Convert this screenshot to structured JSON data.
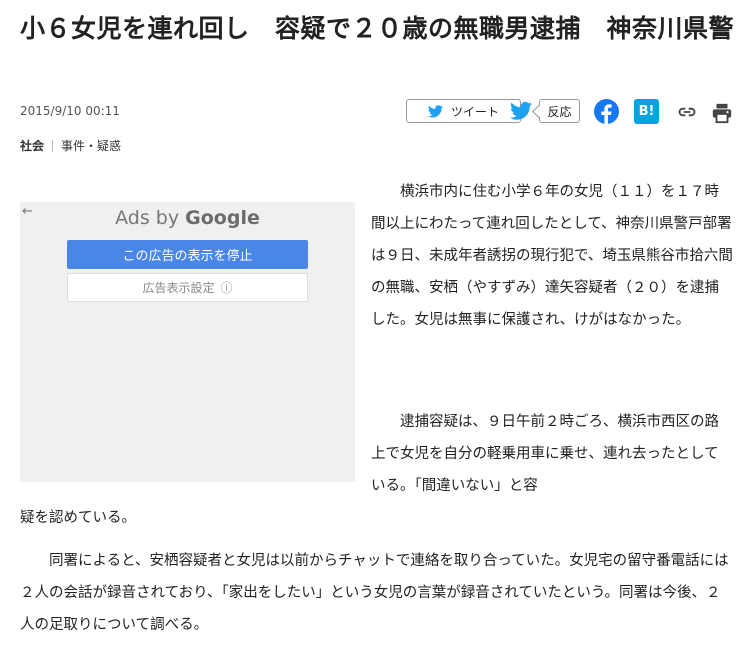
{
  "article": {
    "headline": "小６女児を連れ回し　容疑で２０歳の無職男逮捕　神奈川県警",
    "date": "2015/9/10 00:11",
    "category_primary": "社会",
    "category_secondary": "事件・疑惑",
    "paragraph1_float": "　　横浜市内に住む小学６年の女児（１１）を１７時間以上にわたって連れ回したとして、神奈川県警戸部署は９日、未成年者誘拐の現行犯で、埼玉県熊谷市拾六間の無職、安栖（やすずみ）達矢容疑者（２０）を逮捕した。女児は無事に保護され、けがはなかった。",
    "paragraph2_float": "　　逮捕容疑は、９日午前２時ごろ、横浜市西区の路上で女児を自分の軽乗用車に乗せ、連れ去ったとしている。「間違いない」と容",
    "paragraph2_cont": "疑を認めている。",
    "paragraph3": "　　同署によると、安栖容疑者と女児は以前からチャットで連絡を取り合っていた。女児宅の留守番電話には２人の会話が録音されており、「家出をしたい」という女児の言葉が録音されていたという。同署は今後、２人の足取りについて調べる。"
  },
  "share": {
    "tweet_label": "ツイート",
    "react_label": "反応",
    "hatena_label": "B!"
  },
  "ad": {
    "back_arrow": "←",
    "ads_by_prefix": "Ads by ",
    "ads_by_brand": "Google",
    "stop_label": "この広告の表示を停止",
    "settings_label": "広告表示設定",
    "settings_icon": "ⓘ"
  },
  "colors": {
    "facebook": "#1877f2",
    "twitter": "#1da1f2",
    "hatena": "#00a4de",
    "ad_button": "#4a86e8"
  }
}
